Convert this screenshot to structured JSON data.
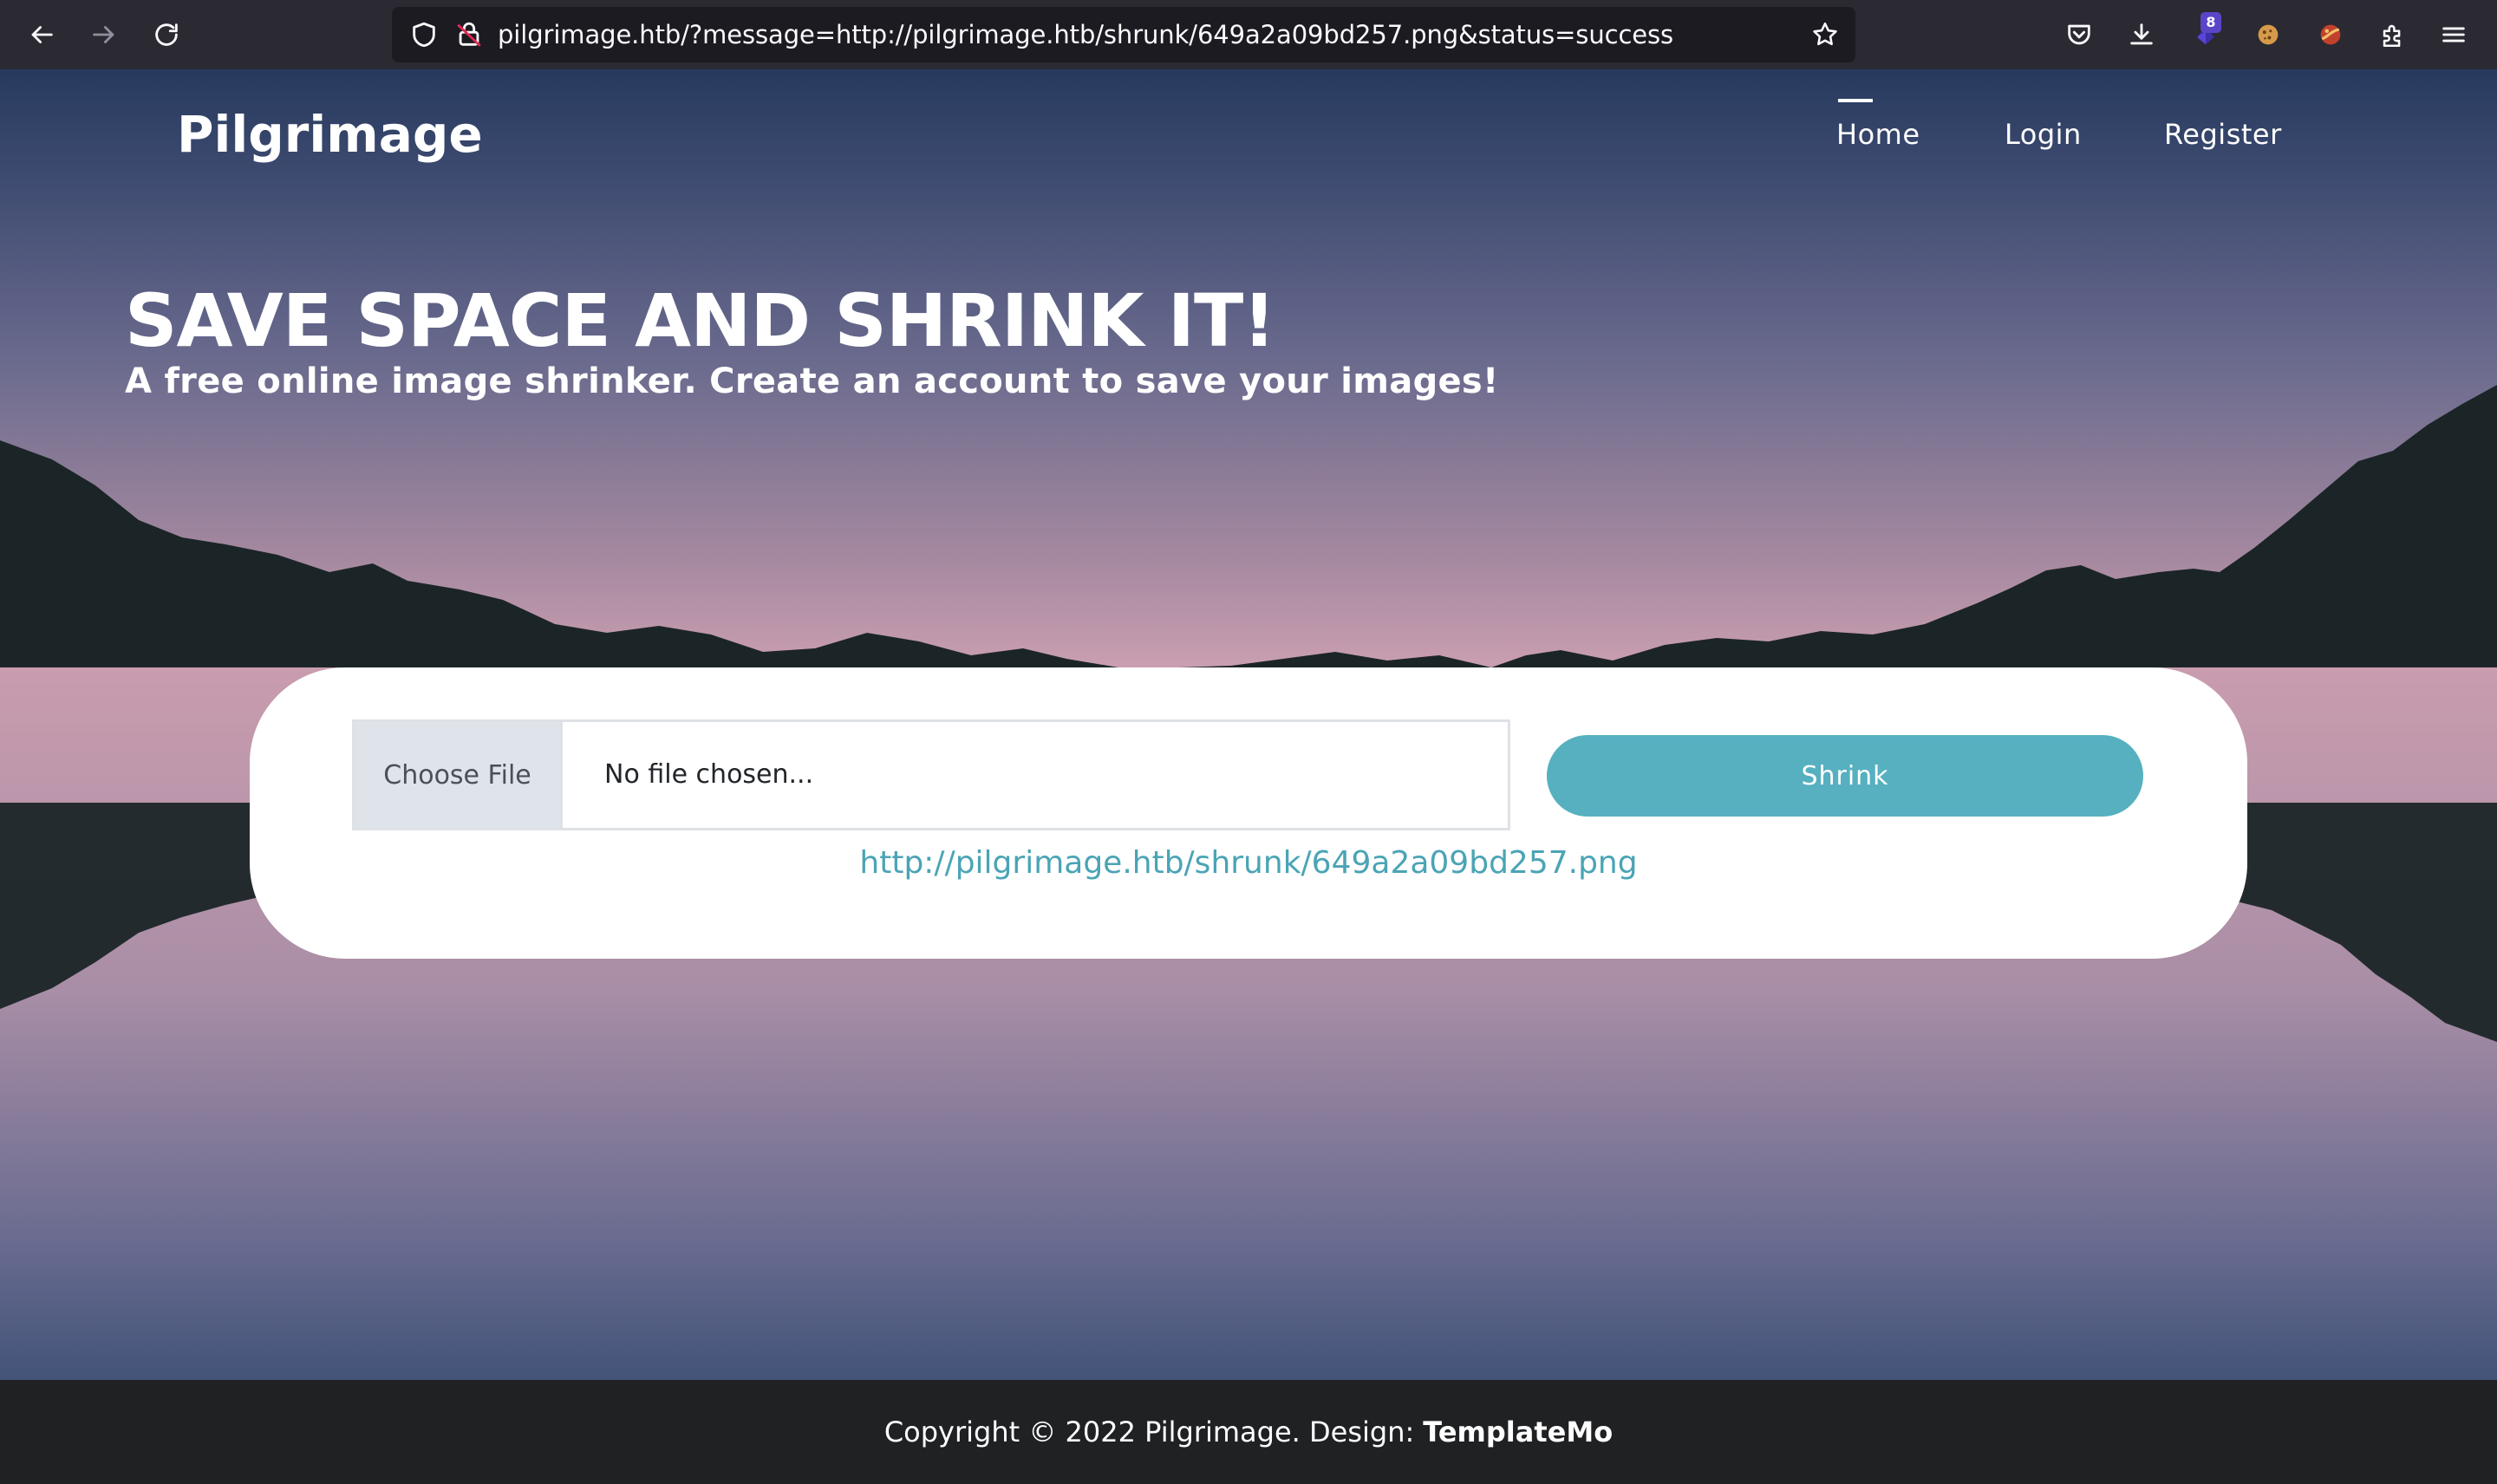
{
  "browser": {
    "url": "pilgrimage.htb/?message=http://pilgrimage.htb/shrunk/649a2a09bd257.png&status=success",
    "extension_badge": "8",
    "icons": [
      "back-icon",
      "forward-icon",
      "reload-icon",
      "shield-icon",
      "insecure-lock-icon",
      "bookmark-star-icon",
      "pocket-icon",
      "download-icon",
      "extension-icon",
      "cookie-icon",
      "extension-icon",
      "extensions-puzzle-icon",
      "menu-icon"
    ]
  },
  "site": {
    "brand": "Pilgrimage",
    "nav": {
      "home": "Home",
      "login": "Login",
      "register": "Register"
    }
  },
  "hero": {
    "title": "SAVE SPACE AND SHRINK IT!",
    "subtitle": "A free online image shrinker. Create an account to save your images!"
  },
  "upload": {
    "choose_label": "Choose File",
    "file_status": "No file chosen...",
    "submit_label": "Shrink",
    "result_url": "http://pilgrimage.htb/shrunk/649a2a09bd257.png"
  },
  "footer": {
    "copyright": "Copyright © 2022 Pilgrimage. Design:",
    "credit": "TemplateMo"
  },
  "colors": {
    "accent": "#56b0c0",
    "link": "#4aa4b5",
    "chrome": "#2b2a33",
    "footer": "#1f2123"
  }
}
